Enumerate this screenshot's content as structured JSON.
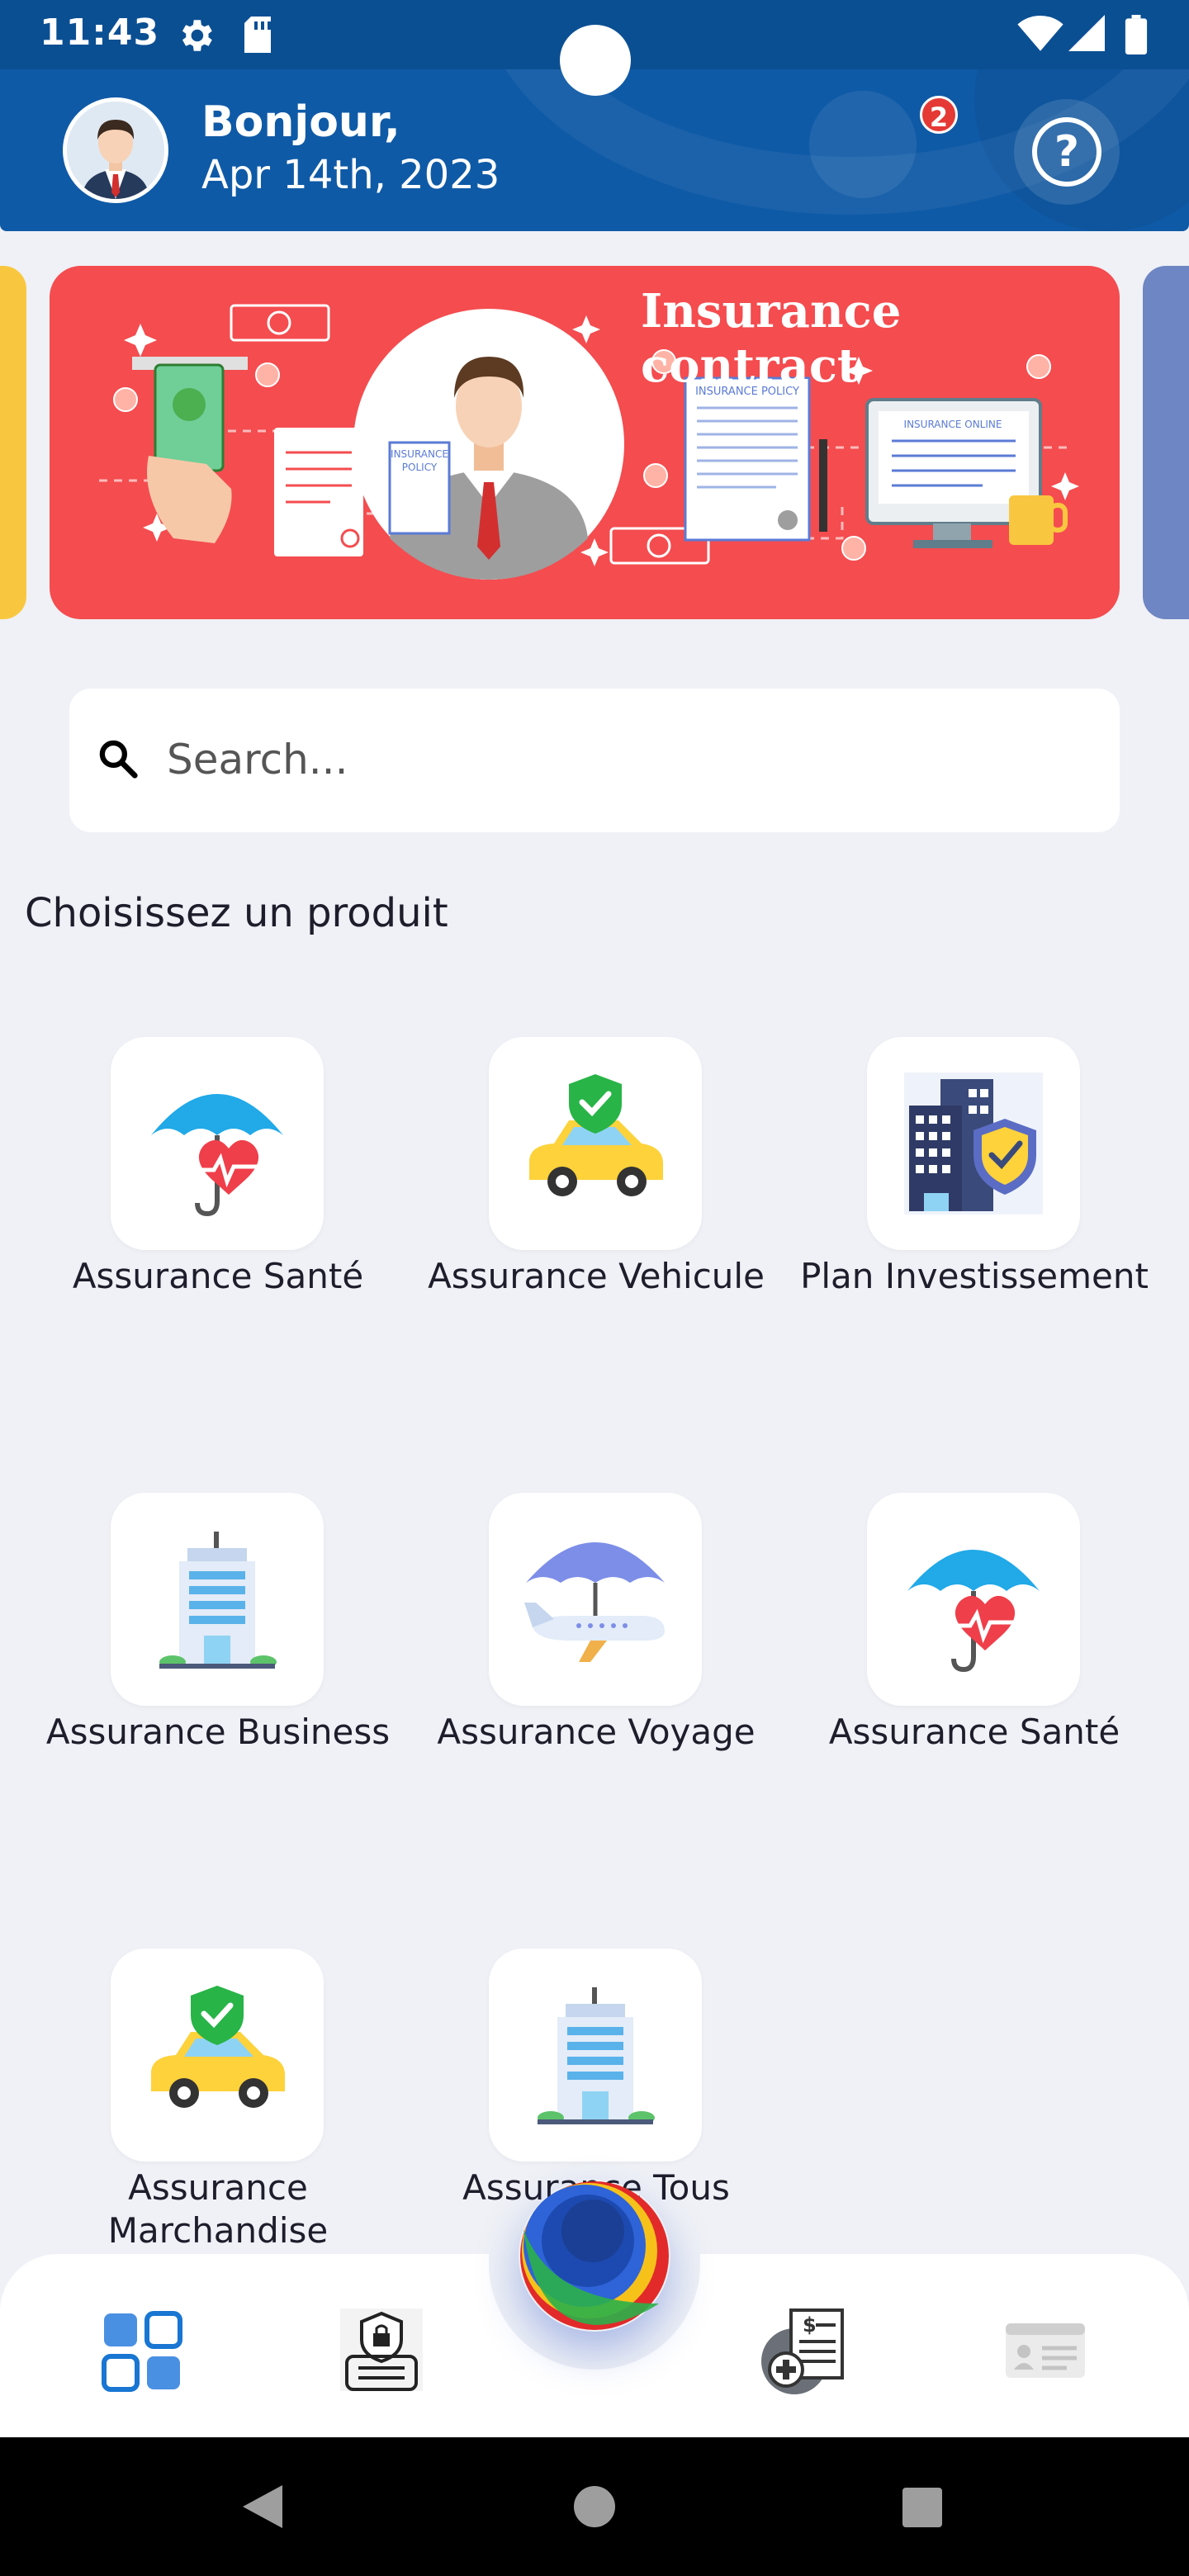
{
  "status_bar": {
    "time": "11:43"
  },
  "header": {
    "greeting": "Bonjour,",
    "date": "Apr 14th, 2023",
    "notification_count": "2"
  },
  "banner": {
    "title": "Insurance contract"
  },
  "search": {
    "placeholder": "Search..."
  },
  "section_title": "Choisissez un produit",
  "products": [
    {
      "label": "Assurance Santé",
      "icon": "health-umbrella-icon"
    },
    {
      "label": "Assurance Vehicule",
      "icon": "car-shield-icon"
    },
    {
      "label": "Plan Investissement",
      "icon": "building-shield-icon"
    },
    {
      "label": "Assurance Business",
      "icon": "office-building-icon"
    },
    {
      "label": "Assurance Voyage",
      "icon": "plane-umbrella-icon"
    },
    {
      "label": "Assurance Santé",
      "icon": "health-umbrella-icon"
    },
    {
      "label": "Assurance Marchandise",
      "icon": "car-shield-icon"
    },
    {
      "label": "Assurance Tous",
      "icon": "office-building-icon"
    }
  ],
  "bottom_nav": [
    {
      "name": "dashboard",
      "icon": "grid-icon"
    },
    {
      "name": "policies",
      "icon": "secure-document-icon"
    },
    {
      "name": "claims",
      "icon": "medical-bill-icon"
    },
    {
      "name": "card",
      "icon": "id-card-icon"
    }
  ],
  "colors": {
    "header": "#0f5aa6",
    "banner": "#f44c4f",
    "accent": "#1976d2",
    "background": "#eff1f6"
  }
}
